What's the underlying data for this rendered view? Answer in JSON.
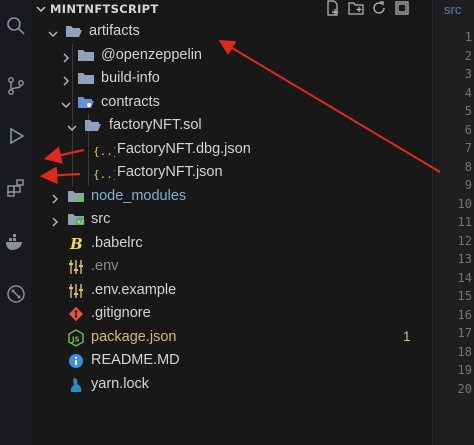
{
  "explorer": {
    "title": "MINTNFTSCRIPT",
    "actions": [
      "new-file-icon",
      "new-folder-icon",
      "refresh-icon",
      "collapse-all-icon"
    ]
  },
  "tree": [
    {
      "label": "artifacts",
      "type": "folder",
      "expanded": true,
      "depth": 0
    },
    {
      "label": "@openzeppelin",
      "type": "folder",
      "expanded": false,
      "depth": 1
    },
    {
      "label": "build-info",
      "type": "folder",
      "expanded": false,
      "depth": 1
    },
    {
      "label": "contracts",
      "type": "folder",
      "expanded": true,
      "depth": 1
    },
    {
      "label": "factoryNFT.sol",
      "type": "folder",
      "expanded": true,
      "depth": 2
    },
    {
      "label": "FactoryNFT.dbg.json",
      "type": "json",
      "depth": 3
    },
    {
      "label": "FactoryNFT.json",
      "type": "json",
      "depth": 3
    },
    {
      "label": "node_modules",
      "type": "folder",
      "expanded": false,
      "depth": 0
    },
    {
      "label": "src",
      "type": "folder",
      "expanded": false,
      "depth": 0
    },
    {
      "label": ".babelrc",
      "type": "babel",
      "depth": 0
    },
    {
      "label": ".env",
      "type": "env",
      "depth": 0
    },
    {
      "label": ".env.example",
      "type": "env",
      "depth": 0
    },
    {
      "label": ".gitignore",
      "type": "git",
      "depth": 0
    },
    {
      "label": "package.json",
      "type": "npm",
      "depth": 0,
      "badge": "1"
    },
    {
      "label": "README.MD",
      "type": "info",
      "depth": 0
    },
    {
      "label": "yarn.lock",
      "type": "yarn",
      "depth": 0
    }
  ],
  "editor": {
    "tab_fragment": "src",
    "line_numbers": [
      "1",
      "2",
      "3",
      "4",
      "5",
      "6",
      "7",
      "8",
      "9",
      "10",
      "11",
      "12",
      "13",
      "14",
      "15",
      "16",
      "17",
      "18",
      "19",
      "20"
    ]
  },
  "colors": {
    "annotation_arrow": "#e0281e",
    "folder": "#8fa3b8",
    "json": "#e2c35a",
    "badge": "#d7ba7d"
  }
}
